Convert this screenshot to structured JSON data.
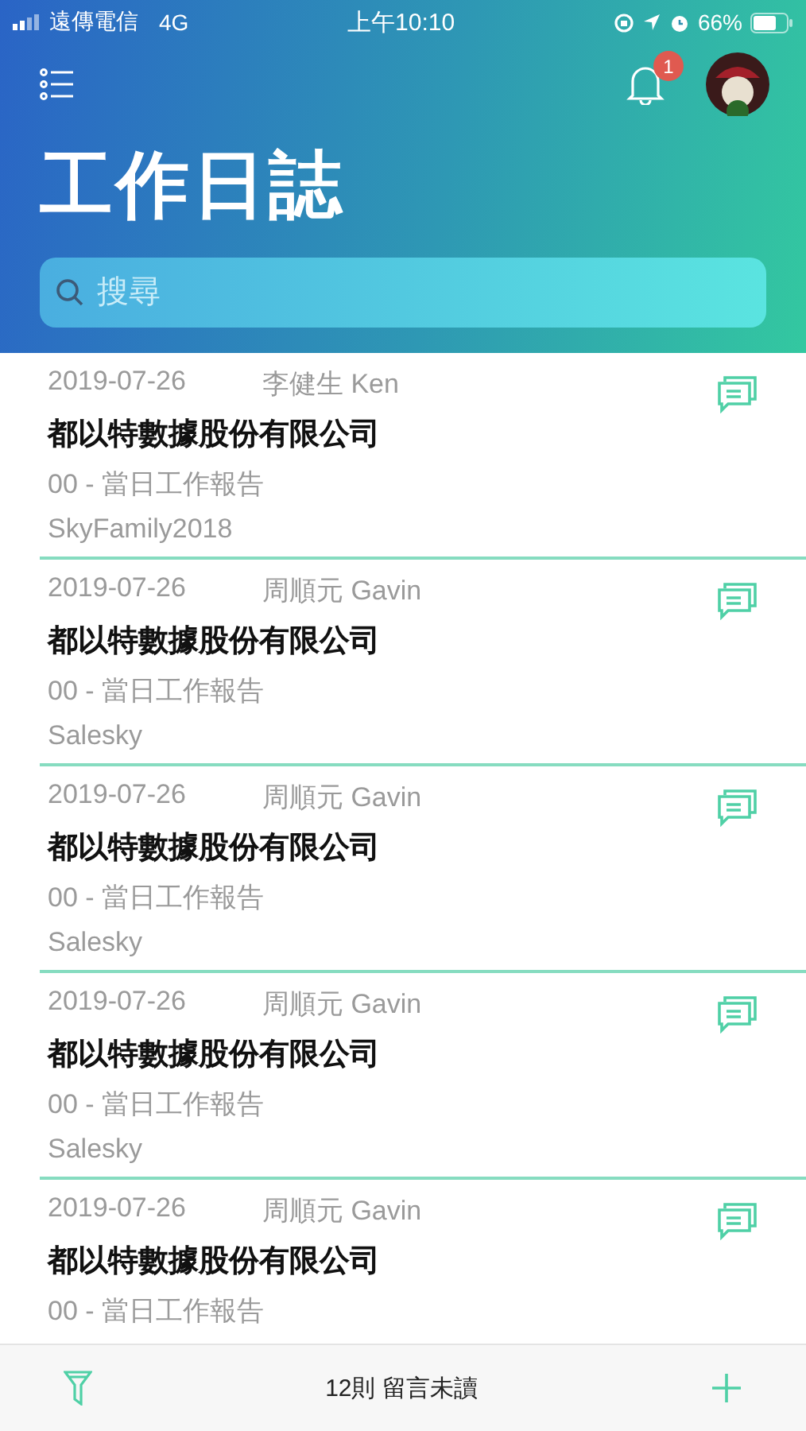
{
  "status_bar": {
    "carrier": "遠傳電信",
    "network": "4G",
    "time": "上午10:10",
    "battery": "66%"
  },
  "header": {
    "title": "工作日誌",
    "notification_count": "1"
  },
  "search": {
    "placeholder": "搜尋"
  },
  "entries": [
    {
      "date": "2019-07-26",
      "author": "李健生 Ken",
      "company": "都以特數據股份有限公司",
      "task": "00 - 當日工作報告",
      "account": "SkyFamily2018"
    },
    {
      "date": "2019-07-26",
      "author": "周順元 Gavin",
      "company": "都以特數據股份有限公司",
      "task": "00 - 當日工作報告",
      "account": "Salesky"
    },
    {
      "date": "2019-07-26",
      "author": "周順元 Gavin",
      "company": "都以特數據股份有限公司",
      "task": "00 - 當日工作報告",
      "account": "Salesky"
    },
    {
      "date": "2019-07-26",
      "author": "周順元 Gavin",
      "company": "都以特數據股份有限公司",
      "task": "00 - 當日工作報告",
      "account": "Salesky"
    },
    {
      "date": "2019-07-26",
      "author": "周順元 Gavin",
      "company": "都以特數據股份有限公司",
      "task": "00 - 當日工作報告"
    }
  ],
  "bottom_bar": {
    "unread": "12則 留言未讀"
  }
}
